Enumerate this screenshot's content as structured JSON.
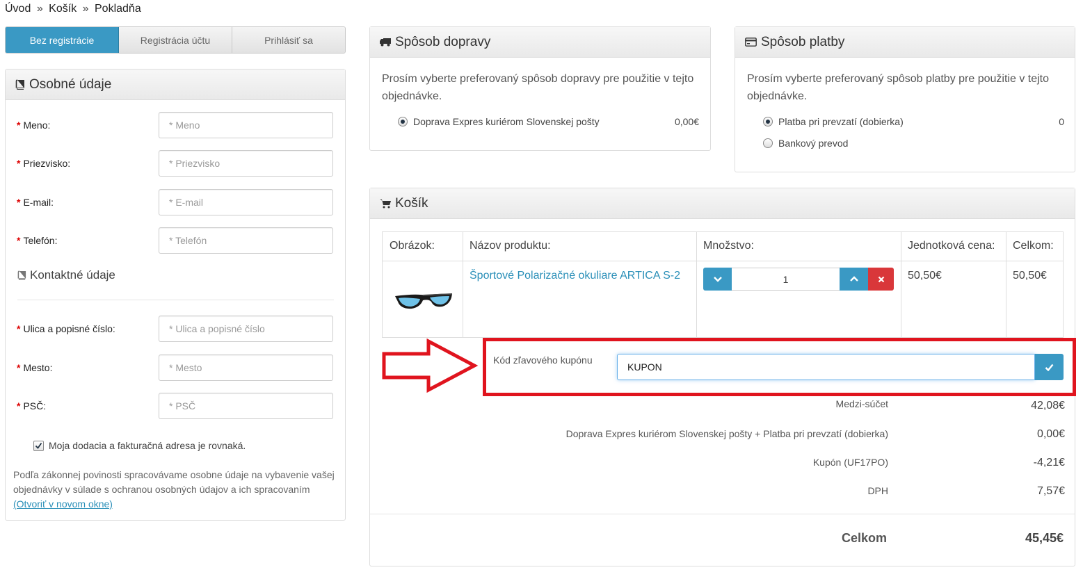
{
  "breadcrumb": {
    "home": "Úvod",
    "sep1": "»",
    "cart": "Košík",
    "sep2": "»",
    "current": "Pokladňa"
  },
  "reg_tabs": [
    "Bez registrácie",
    "Registrácia účtu",
    "Prihlásiť sa"
  ],
  "personal": {
    "title": "Osobné údaje",
    "fields": [
      {
        "label": "Meno:",
        "placeholder": "* Meno"
      },
      {
        "label": "Priezvisko:",
        "placeholder": "* Priezvisko"
      },
      {
        "label": "E-mail:",
        "placeholder": "* E-mail"
      },
      {
        "label": "Telefón:",
        "placeholder": "* Telefón"
      }
    ],
    "required_mark": "*"
  },
  "contact": {
    "title": "Kontaktné údaje",
    "fields": [
      {
        "label": "Ulica a popisné číslo:",
        "placeholder": "* Ulica a popisné číslo"
      },
      {
        "label": "Mesto:",
        "placeholder": "* Mesto"
      },
      {
        "label": "PSČ:",
        "placeholder": "* PSČ"
      }
    ]
  },
  "same_address": {
    "label": "Moja dodacia a fakturačná adresa je rovnaká.",
    "checked": true
  },
  "gdpr": {
    "text": "Podľa zákonnej povinosti spracovávame osobne údaje na vybavenie vašej objednávky v súlade s ochranou osobných údajov a ich spracovaním",
    "link": "(Otvoriť v novom okne)"
  },
  "shipping": {
    "title": "Spôsob dopravy",
    "desc": "Prosím vyberte preferovaný spôsob dopravy pre použitie v tejto objednávke.",
    "options": [
      {
        "label": "Doprava Expres kuriérom Slovenskej pošty",
        "price": "0,00€",
        "selected": true
      }
    ]
  },
  "payment": {
    "title": "Spôsob platby",
    "desc": "Prosím vyberte preferovaný spôsob platby pre použitie v tejto objednávke.",
    "options": [
      {
        "label": "Platba pri prevzatí (dobierka)",
        "price": "0",
        "selected": true
      },
      {
        "label": "Bankový prevod",
        "price": "",
        "selected": false
      }
    ]
  },
  "cart": {
    "title": "Košík",
    "headers": [
      "Obrázok:",
      "Názov produktu:",
      "Množstvo:",
      "Jednotková cena:",
      "Celkom:"
    ],
    "item": {
      "name": "Športové Polarizačné okuliare ARTICA S-2",
      "qty": "1",
      "unit_price": "50,50€",
      "total": "50,50€"
    }
  },
  "coupon": {
    "label": "Kód zľavového kupónu",
    "value": "KUPON"
  },
  "totals": [
    {
      "label": "Medzi-súčet",
      "value": "42,08€"
    },
    {
      "label": "Doprava Expres kuriérom Slovenskej pošty + Platba pri prevzatí (dobierka)",
      "value": "0,00€"
    },
    {
      "label": "Kupón (UF17PO)",
      "value": "-4,21€"
    },
    {
      "label": "DPH",
      "value": "7,57€"
    }
  ],
  "grand_total": {
    "label": "Celkom",
    "value": "45,45€"
  },
  "colors": {
    "accent": "#3a99c4",
    "highlight_red": "#e0141e",
    "remove_red": "#d9373a",
    "link": "#2a8fb8"
  }
}
